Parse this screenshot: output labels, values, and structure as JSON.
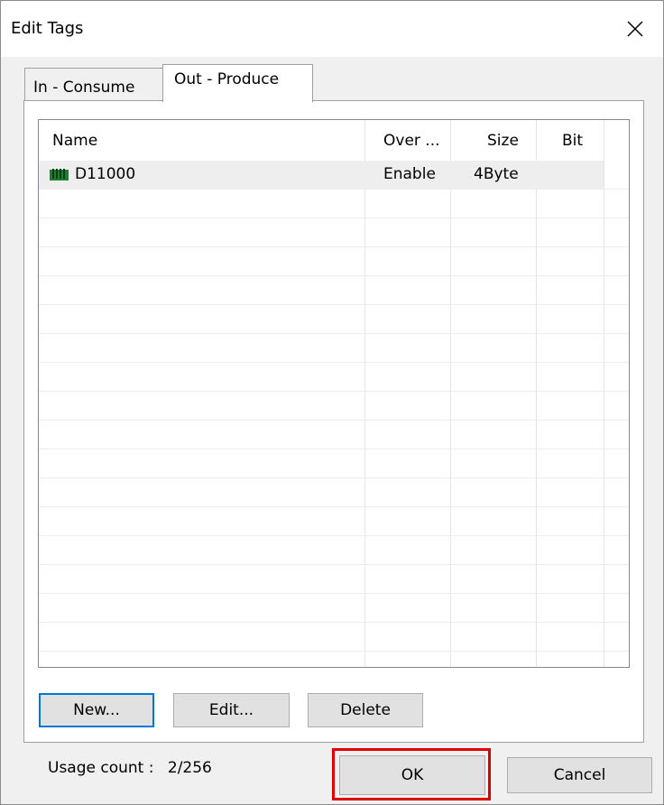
{
  "window": {
    "title": "Edit Tags"
  },
  "tabs": [
    {
      "label": "In - Consume",
      "active": false
    },
    {
      "label": "Out - Produce",
      "active": true
    }
  ],
  "list": {
    "columns": [
      "Name",
      "Over ...",
      "Size",
      "Bit"
    ],
    "rows": [
      {
        "icon": "device-tag-icon",
        "name": "D11000",
        "override": "Enable",
        "size": "4Byte",
        "bit": ""
      }
    ]
  },
  "buttons": {
    "new_label": "New...",
    "edit_label": "Edit...",
    "delete_label": "Delete",
    "ok_label": "OK",
    "cancel_label": "Cancel"
  },
  "usage": {
    "label": "Usage count :",
    "value": "2/256"
  },
  "colors": {
    "highlight": "#e00000",
    "default_button_border": "#0078d7",
    "icon": "#1e7d32"
  }
}
